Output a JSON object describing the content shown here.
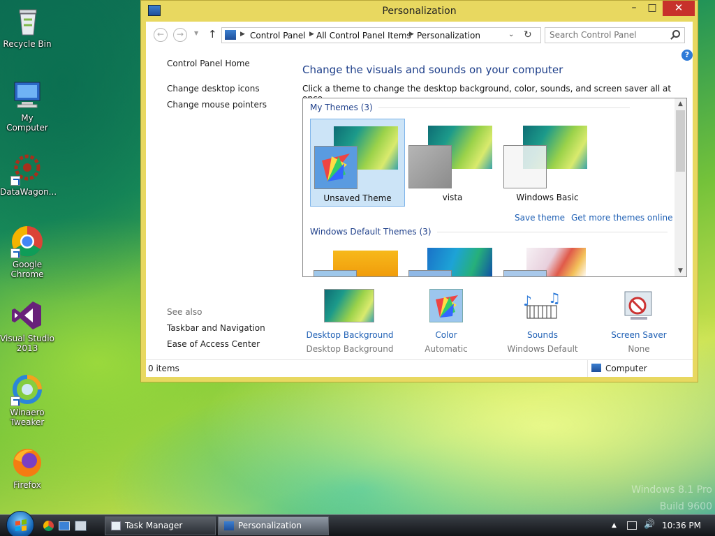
{
  "desktop": {
    "icons": [
      {
        "label": "Recycle Bin",
        "icon": "recycle-bin-icon"
      },
      {
        "label": "My Computer",
        "icon": "computer-icon"
      },
      {
        "label": "DataWagon...",
        "icon": "datawagon-icon"
      },
      {
        "label": "Google Chrome",
        "icon": "chrome-icon"
      },
      {
        "label": "Visual Studio 2013",
        "icon": "visual-studio-icon"
      },
      {
        "label": "Winaero Tweaker",
        "icon": "winaero-tweaker-icon"
      },
      {
        "label": "Firefox",
        "icon": "firefox-icon"
      }
    ],
    "watermark_line1": "Windows 8.1 Pro",
    "watermark_line2": "Build 9600"
  },
  "window": {
    "title": "Personalization",
    "min": "–",
    "max": "□",
    "close": "✕",
    "breadcrumb": [
      "Control Panel",
      "All Control Panel Items",
      "Personalization"
    ],
    "search_placeholder": "Search Control Panel",
    "left_links": [
      "Control Panel Home",
      "Change desktop icons",
      "Change mouse pointers"
    ],
    "see_also": "See also",
    "see_also_links": [
      "Taskbar and Navigation",
      "Ease of Access Center"
    ],
    "heading": "Change the visuals and sounds on your computer",
    "description": "Click a theme to change the desktop background, color, sounds, and screen saver all at once.",
    "my_themes_header": "My Themes (3)",
    "themes": [
      "Unsaved Theme",
      "vista",
      "Windows Basic"
    ],
    "save_theme": "Save theme",
    "get_more": "Get more themes online",
    "default_themes_header": "Windows Default Themes (3)",
    "tools": [
      {
        "name": "Desktop Background",
        "sub": "Desktop Background"
      },
      {
        "name": "Color",
        "sub": "Automatic"
      },
      {
        "name": "Sounds",
        "sub": "Windows Default"
      },
      {
        "name": "Screen Saver",
        "sub": "None"
      }
    ],
    "status_left": "0 items",
    "status_right": "Computer"
  },
  "taskbar": {
    "tasks": [
      "Task Manager",
      "Personalization"
    ],
    "clock": "10:36 PM"
  }
}
